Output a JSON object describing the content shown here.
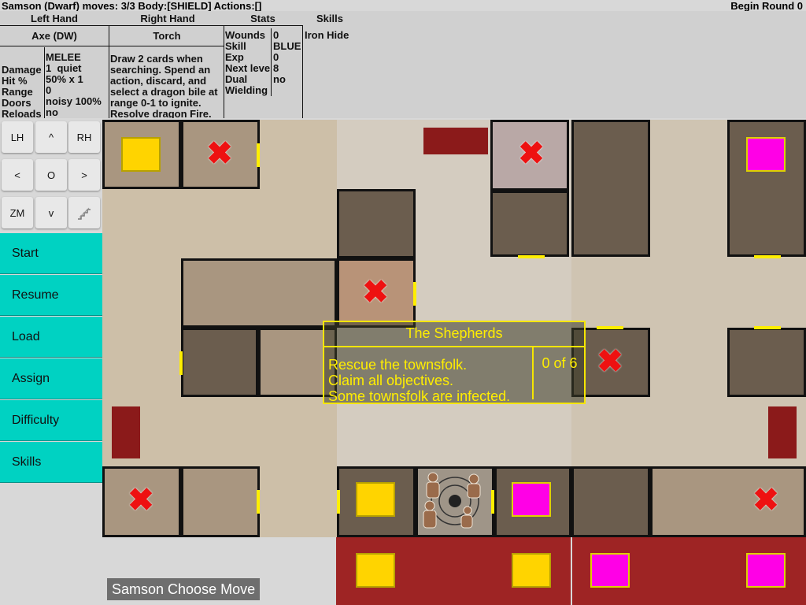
{
  "status": {
    "left": "Samson (Dwarf) moves: 3/3 Body:[SHIELD] Actions:[]",
    "right": "Begin Round 0"
  },
  "columns": {
    "left_hand": "Left Hand",
    "right_hand": "Right Hand",
    "stats": "Stats",
    "skills": "Skills"
  },
  "left_hand": {
    "name": "Axe (DW)",
    "labels": "Damage\nHit %\nRange\nDoors\nReloads",
    "values": "MELEE\n1  quiet\n50% x 1\n0\nnoisy 100%\nno"
  },
  "right_hand": {
    "name": "Torch",
    "text": "Draw 2 cards when\nsearching. Spend an\naction, discard, and\nselect a dragon bile at\nrange 0-1 to ignite.\nResolve dragon Fire."
  },
  "stats": {
    "labels": "Wounds\nSkill\nExp\nNext level\nDual\nWielding",
    "values": "0\nBLUE\n0\n8\nno"
  },
  "skills": {
    "text": "Iron Hide"
  },
  "controls": {
    "lh": "LH",
    "up": "^",
    "rh": "RH",
    "left": "<",
    "center": "O",
    "right": ">",
    "zm": "ZM",
    "down": "v"
  },
  "menu": [
    "Start",
    "Resume",
    "Load",
    "Assign",
    "Difficulty",
    "Skills"
  ],
  "objective": {
    "title": "The Shepherds",
    "lines": [
      "Rescue the townsfolk.",
      "Claim all objectives.",
      "Some townsfolk are infected."
    ],
    "progress": "0 of 6"
  },
  "message": "Samson Choose Move",
  "colors": {
    "menu": "#00d2c2",
    "objective_yellow": "#ffd400",
    "objective_magenta": "#ff00e6",
    "x_marker": "#ee1111",
    "tray": "#9e2424",
    "popup_border": "#f5e600"
  }
}
